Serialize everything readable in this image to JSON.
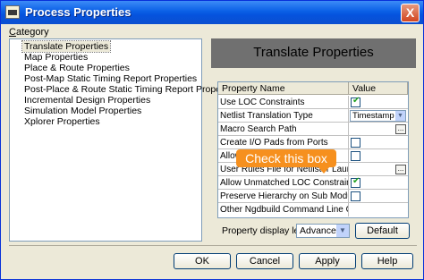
{
  "window": {
    "title": "Process Properties",
    "close_glyph": "X"
  },
  "category": {
    "label_underline": "C",
    "label_rest": "ategory",
    "items": [
      "Translate Properties",
      "Map Properties",
      "Place & Route Properties",
      "Post-Map Static Timing Report Properties",
      "Post-Place & Route Static Timing Report Properties",
      "Incremental Design Properties",
      "Simulation Model Properties",
      "Xplorer Properties"
    ]
  },
  "panel": {
    "title": "Translate Properties"
  },
  "table": {
    "headers": [
      "Property Name",
      "Value"
    ],
    "rows": [
      {
        "name": "Use LOC Constraints",
        "kind": "checkbox",
        "checked": true
      },
      {
        "name": "Netlist Translation Type",
        "kind": "combo",
        "value": "Timestamp"
      },
      {
        "name": "Macro Search Path",
        "kind": "browse",
        "value": "..."
      },
      {
        "name": "Create I/O Pads from Ports",
        "kind": "checkbox",
        "checked": false
      },
      {
        "name": "Allow",
        "kind": "checkbox",
        "checked": false
      },
      {
        "name": "User Rules File for Netlister Launcher",
        "kind": "browse",
        "value": "..."
      },
      {
        "name": "Allow Unmatched LOC Constraints",
        "kind": "checkbox",
        "checked": true
      },
      {
        "name": "Preserve Hierarchy on Sub Module",
        "kind": "checkbox",
        "checked": false
      },
      {
        "name": "Other Ngdbuild Command Line Options",
        "kind": "text",
        "value": ""
      }
    ]
  },
  "tooltip": {
    "text": "Check this box"
  },
  "display_level": {
    "label": "Property display level:",
    "value": "Advanced"
  },
  "buttons": {
    "default": "Default",
    "ok": "OK",
    "cancel": "Cancel",
    "apply": "Apply",
    "help": "Help"
  },
  "icons": {
    "dropdown": "▼"
  }
}
